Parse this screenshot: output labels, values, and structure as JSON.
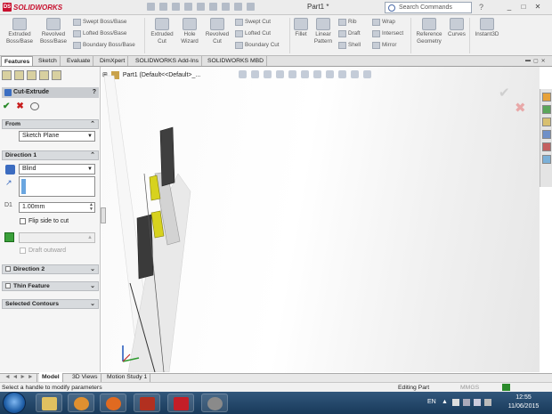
{
  "app": {
    "name": "SOLIDWORKS",
    "doc_title": "Part1 *"
  },
  "search": {
    "placeholder": "Search Commands"
  },
  "ribbon": {
    "extruded_boss": "Extruded\nBoss/Base",
    "revolved_boss": "Revolved\nBoss/Base",
    "swept_boss": "Swept Boss/Base",
    "lofted_boss": "Lofted Boss/Base",
    "boundary_boss": "Boundary Boss/Base",
    "extruded_cut": "Extruded\nCut",
    "hole_wizard": "Hole\nWizard",
    "revolved_cut": "Revolved\nCut",
    "swept_cut": "Swept Cut",
    "lofted_cut": "Lofted Cut",
    "boundary_cut": "Boundary Cut",
    "fillet": "Fillet",
    "linear_pattern": "Linear\nPattern",
    "rib": "Rib",
    "draft": "Draft",
    "shell": "Shell",
    "wrap": "Wrap",
    "intersect": "Intersect",
    "mirror": "Mirror",
    "reference_geometry": "Reference\nGeometry",
    "curves": "Curves",
    "instant3d": "Instant3D"
  },
  "tabs": [
    "Features",
    "Sketch",
    "Evaluate",
    "DimXpert",
    "SOLIDWORKS Add-Ins",
    "SOLIDWORKS MBD"
  ],
  "pm": {
    "title": "Cut-Extrude",
    "help": "?",
    "from_label": "From",
    "from_value": "Sketch Plane",
    "direction1_label": "Direction 1",
    "end_condition": "Blind",
    "depth": "1.00mm",
    "flip_side": "Flip side to cut",
    "draft_outward": "Draft outward",
    "direction2_label": "Direction 2",
    "thin_feature_label": "Thin Feature",
    "selected_contours_label": "Selected Contours"
  },
  "viewport": {
    "tree_label": "Part1  (Default<<Default>_..."
  },
  "bottom_tabs": [
    "Model",
    "3D Views",
    "Motion Study 1"
  ],
  "status": {
    "message": "Select a handle to modify parameters",
    "mode": "Editing Part",
    "units": "MMGS"
  },
  "clock": {
    "time": "12:55",
    "date": "11/06/2015"
  }
}
